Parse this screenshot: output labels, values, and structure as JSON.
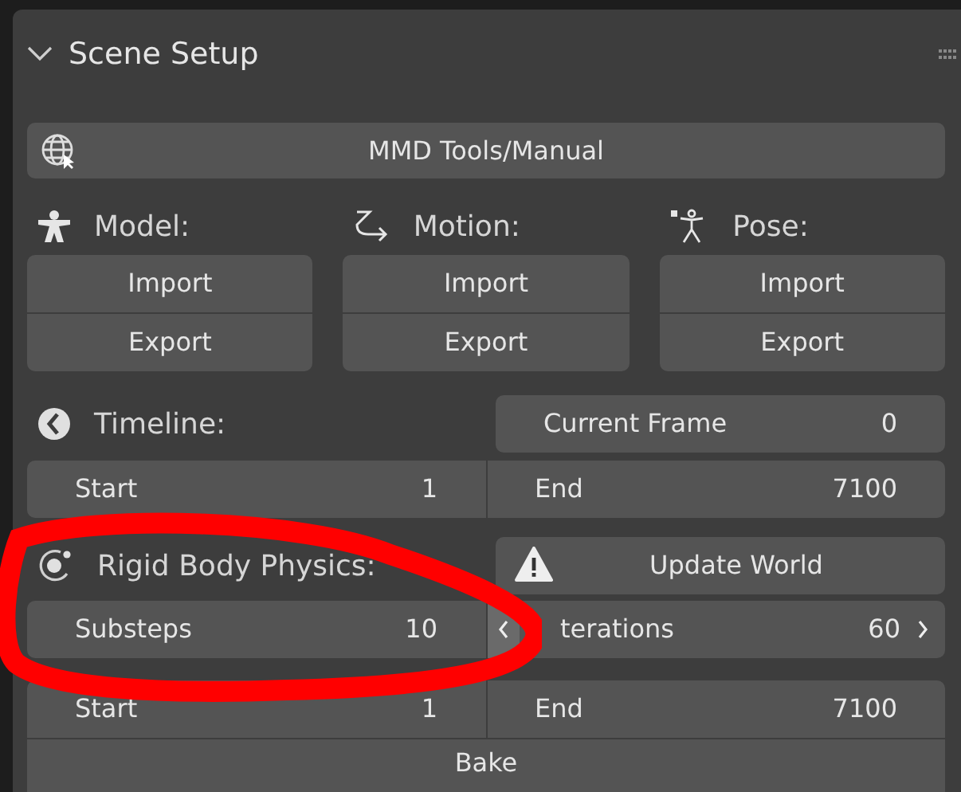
{
  "panel": {
    "title": "Scene Setup",
    "expanded": true
  },
  "manual_button": {
    "label": "MMD Tools/Manual"
  },
  "io_groups": [
    {
      "kind": "model",
      "label": "Model:",
      "buttons": [
        "Import",
        "Export"
      ]
    },
    {
      "kind": "motion",
      "label": "Motion:",
      "buttons": [
        "Import",
        "Export"
      ]
    },
    {
      "kind": "pose",
      "label": "Pose:",
      "buttons": [
        "Import",
        "Export"
      ]
    }
  ],
  "timeline": {
    "label": "Timeline:",
    "current_frame": {
      "label": "Current Frame",
      "value": "0"
    },
    "start": {
      "label": "Start",
      "value": "1"
    },
    "end": {
      "label": "End",
      "value": "7100"
    }
  },
  "rigid_body": {
    "label": "Rigid Body Physics:",
    "update_button": "Update World",
    "substeps": {
      "label": "Substeps",
      "value": "10"
    },
    "iterations": {
      "label": "terations",
      "value": "60"
    },
    "start": {
      "label": "Start",
      "value": "1"
    },
    "end": {
      "label": "End",
      "value": "7100"
    },
    "bake_button": "Bake"
  }
}
